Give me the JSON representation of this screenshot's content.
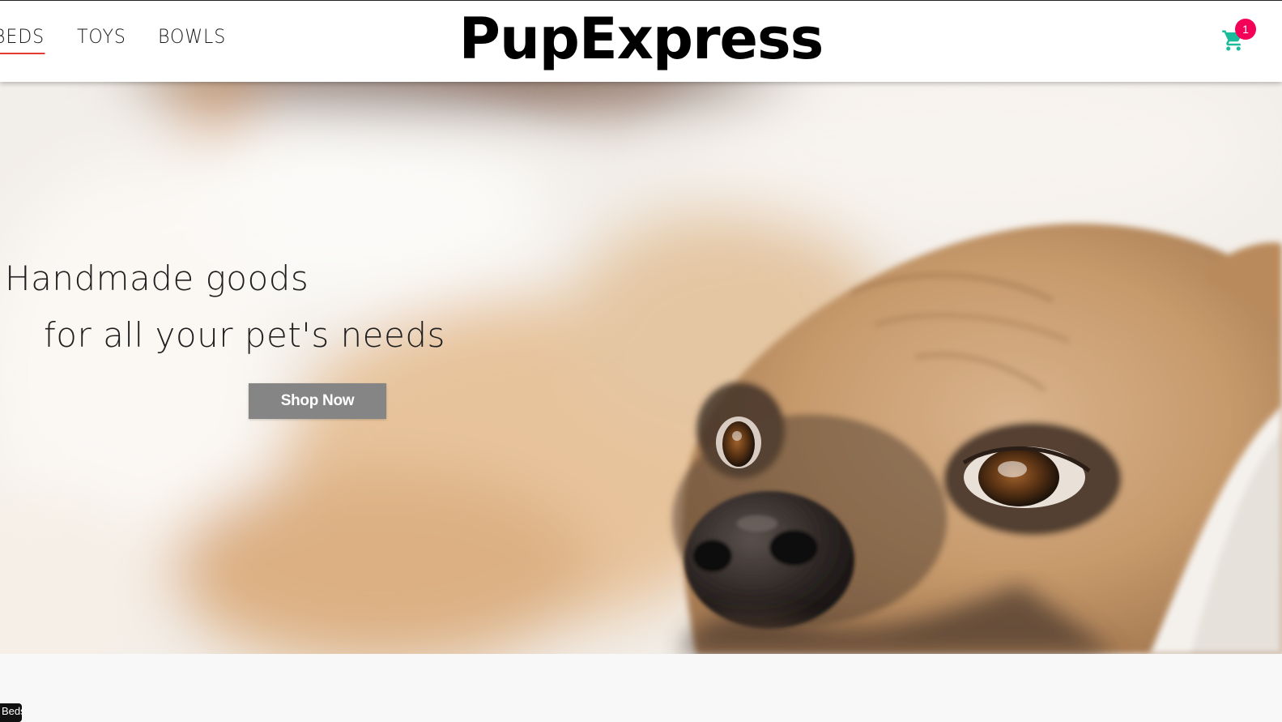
{
  "header": {
    "brand": "PupExpress",
    "nav": [
      {
        "label": "BEDS",
        "active": true
      },
      {
        "label": "TOYS",
        "active": false
      },
      {
        "label": "BOWLS",
        "active": false
      }
    ],
    "cart": {
      "icon": "shopping-cart-icon",
      "count": "1",
      "icon_color": "#1abc9c",
      "badge_color": "#f50057"
    }
  },
  "hero": {
    "image": "pug-lying-down-photo",
    "line1": "Handmade goods",
    "line2": "for all your pet's needs",
    "cta": "Shop Now"
  },
  "tooltip": {
    "text": "Beds"
  },
  "colors": {
    "active_underline": "#e53935",
    "cta_background": "#858585"
  }
}
